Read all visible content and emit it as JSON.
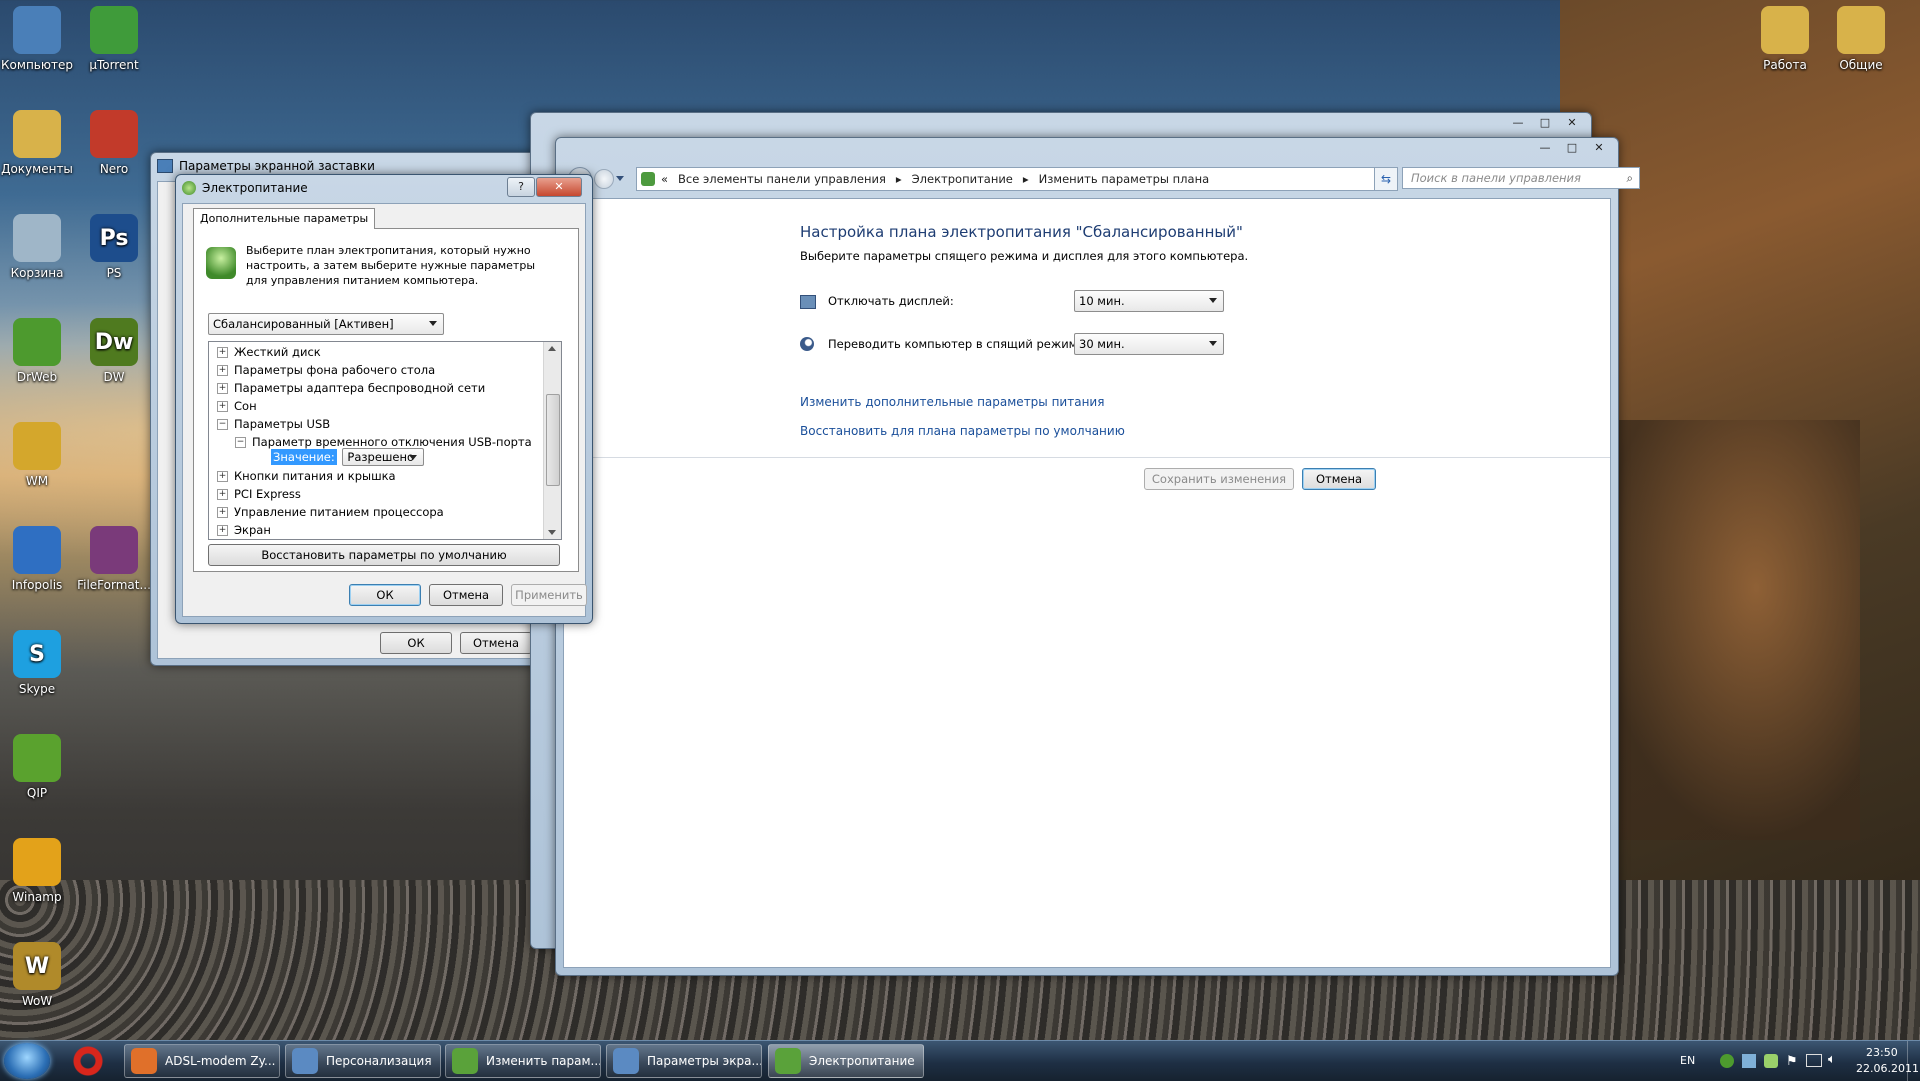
{
  "desktop": {
    "icons_left": [
      {
        "label": "Компьютер",
        "icon": "computer-icon",
        "color": "#4a7fb8"
      },
      {
        "label": "µTorrent",
        "icon": "utorrent-icon",
        "color": "#3f9b3a"
      },
      {
        "label": "Документы",
        "icon": "folder-icon",
        "color": "#d8b24a"
      },
      {
        "label": "Nero",
        "icon": "nero-icon",
        "color": "#c23a2a"
      },
      {
        "label": "Корзина",
        "icon": "recycle-bin-icon",
        "color": "#9fb6c8"
      },
      {
        "label": "PS",
        "icon": "photoshop-icon",
        "color": "#1d4d8c",
        "glyph": "Ps"
      },
      {
        "label": "DrWeb",
        "icon": "drweb-icon",
        "color": "#4d9a2e"
      },
      {
        "label": "DW",
        "icon": "dreamweaver-icon",
        "color": "#4f7a1f",
        "glyph": "Dw"
      },
      {
        "label": "WM",
        "icon": "webmoney-icon",
        "color": "#d4a72c"
      },
      {
        "label": "Infopolis",
        "icon": "infopolis-icon",
        "color": "#2f6fc2"
      },
      {
        "label": "FileFormat...",
        "icon": "winrar-icon",
        "color": "#7a3a7a"
      },
      {
        "label": "Skype",
        "icon": "skype-icon",
        "color": "#1ea0e0",
        "glyph": "S"
      },
      {
        "label": "QIP",
        "icon": "qip-icon",
        "color": "#5aa22e"
      },
      {
        "label": "Winamp",
        "icon": "winamp-icon",
        "color": "#e3a21a"
      },
      {
        "label": "WoW",
        "icon": "wow-icon",
        "color": "#b08a2a",
        "glyph": "W"
      }
    ],
    "icons_right": [
      {
        "label": "Работа",
        "icon": "folder-icon",
        "color": "#d8b24a"
      },
      {
        "label": "Общие",
        "icon": "folder-icon",
        "color": "#d8b24a"
      }
    ]
  },
  "screensaver_window": {
    "title": "Параметры экранной заставки",
    "ok": "ОК",
    "cancel": "Отмена",
    "apply_partial": "П"
  },
  "control_panel": {
    "breadcrumb": [
      "Все элементы панели управления",
      "Электропитание",
      "Изменить параметры плана"
    ],
    "search_placeholder": "Поиск в панели управления",
    "heading": "Настройка плана электропитания \"Сбалансированный\"",
    "subheading": "Выберите параметры спящего режима и дисплея для этого компьютера.",
    "display_label": "Отключать дисплей:",
    "display_value": "10 мин.",
    "sleep_label": "Переводить компьютер в спящий режим:",
    "sleep_value": "30 мин.",
    "link_advanced": "Изменить дополнительные параметры питания",
    "link_restore": "Восстановить для плана параметры по умолчанию",
    "save": "Сохранить изменения",
    "cancel": "Отмена"
  },
  "power_dialog": {
    "title": "Электропитание",
    "help": "?",
    "tab": "Дополнительные параметры",
    "description": "Выберите план электропитания, который нужно настроить, а затем выберите нужные параметры для управления питанием компьютера.",
    "plan_value": "Сбалансированный [Активен]",
    "tree": [
      {
        "label": "Жесткий диск",
        "sign": "+",
        "level": 0
      },
      {
        "label": "Параметры фона рабочего стола",
        "sign": "+",
        "level": 0
      },
      {
        "label": "Параметры адаптера беспроводной сети",
        "sign": "+",
        "level": 0
      },
      {
        "label": "Сон",
        "sign": "+",
        "level": 0
      },
      {
        "label": "Параметры USB",
        "sign": "−",
        "level": 0
      },
      {
        "label": "Параметр временного отключения USB-порта",
        "sign": "−",
        "level": 1
      }
    ],
    "tree_after": [
      {
        "label": "Кнопки питания и крышка",
        "sign": "+"
      },
      {
        "label": "PCI Express",
        "sign": "+"
      },
      {
        "label": "Управление питанием процессора",
        "sign": "+"
      },
      {
        "label": "Экран",
        "sign": "+"
      }
    ],
    "value_label": "Значение:",
    "value_selected": "Разрешено",
    "restore_defaults": "Восстановить параметры по умолчанию",
    "ok": "ОК",
    "cancel": "Отмена",
    "apply": "Применить"
  },
  "taskbar": {
    "items": [
      {
        "label": "ADSL-modem Zy...",
        "icon": "firefox-icon",
        "color": "#e0702a"
      },
      {
        "label": "Персонализация",
        "icon": "personalization-icon",
        "color": "#5b8ac2"
      },
      {
        "label": "Изменить парам...",
        "icon": "power-options-icon",
        "color": "#5aa23a"
      },
      {
        "label": "Параметры экра...",
        "icon": "screensaver-icon",
        "color": "#5b8ac2"
      },
      {
        "label": "Электропитание",
        "icon": "power-options-icon",
        "color": "#5aa23a"
      }
    ],
    "language": "EN",
    "time": "23:50",
    "date": "22.06.2011"
  }
}
